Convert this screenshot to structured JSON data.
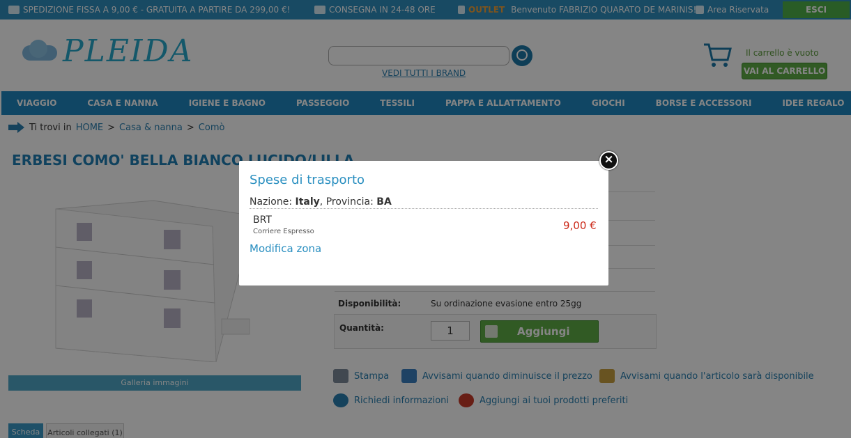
{
  "topbar": {
    "shipping": "SPEDIZIONE FISSA A 9,00 € - GRATUITA A PARTIRE DA 299,00 €!",
    "delivery": "CONSEGNA IN 24-48 ORE",
    "outlet": "OUTLET",
    "welcome": "Benvenuto FABRIZIO QUARATO DE MARINIS!",
    "reserved": "Area Riservata",
    "logout": "ESCI"
  },
  "header": {
    "logo_text": "PLEIDA",
    "search_placeholder": "",
    "brands_link": "VEDI TUTTI I BRAND",
    "cart_status": "Il carrello è vuoto",
    "cart_button": "VAI AL CARRELLO"
  },
  "nav": [
    "VIAGGIO",
    "CASA E NANNA",
    "IGIENE E BAGNO",
    "PASSEGGIO",
    "TESSILI",
    "PAPPA E ALLATTAMENTO",
    "GIOCHI",
    "BORSE E ACCESSORI",
    "IDEE REGALO"
  ],
  "breadcrumb": {
    "prefix": "Ti trovi in",
    "items": [
      "HOME",
      "Casa & nanna",
      "Comò"
    ]
  },
  "product": {
    "title": "ERBESI COMO' BELLA BIANCO LUCIDO/LILLA",
    "gallery_label": "Galleria immagini",
    "availability_label": "Disponibilità:",
    "availability_value": "Su ordinazione evasione entro 25gg",
    "quantity_label": "Quantità:",
    "quantity_value": "1",
    "add_button": "Aggiungi"
  },
  "actions": {
    "print": "Stampa",
    "price_alert": "Avvisami quando diminuisce il prezzo",
    "stock_alert": "Avvisami quando l'articolo sarà disponibile",
    "info": "Richiedi informazioni",
    "favorites": "Aggiungi ai tuoi prodotti preferiti"
  },
  "tabs": [
    "Scheda",
    "Articoli collegati (1)"
  ],
  "modal": {
    "title": "Spese di trasporto",
    "country_label": "Nazione:",
    "country": "Italy",
    "province_label": "Provincia:",
    "province": "BA",
    "courier": "BRT",
    "courier_sub": "Corriere Espresso",
    "price": "9,00 €",
    "modify": "Modifica zona",
    "close": "×"
  }
}
